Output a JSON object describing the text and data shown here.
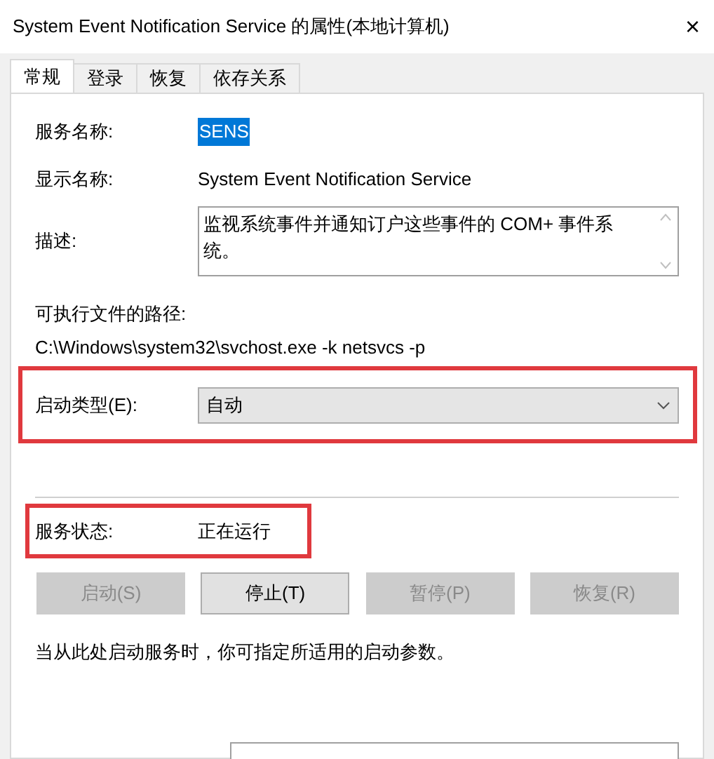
{
  "window": {
    "title": "System Event Notification Service 的属性(本地计算机)",
    "close": "×"
  },
  "tabs": [
    {
      "label": "常规",
      "selected": true
    },
    {
      "label": "登录",
      "selected": false
    },
    {
      "label": "恢复",
      "selected": false
    },
    {
      "label": "依存关系",
      "selected": false
    }
  ],
  "service_name": {
    "label": "服务名称:",
    "value": "SENS"
  },
  "display_name": {
    "label": "显示名称:",
    "value": "System Event Notification Service"
  },
  "description": {
    "label": "描述:",
    "value": "监视系统事件并通知订户这些事件的 COM+ 事件系统。"
  },
  "path": {
    "label": "可执行文件的路径:",
    "value": "C:\\Windows\\system32\\svchost.exe -k netsvcs -p"
  },
  "startup_type": {
    "label": "启动类型(E):",
    "value": "自动"
  },
  "service_status": {
    "label": "服务状态:",
    "value": "正在运行"
  },
  "buttons": [
    {
      "label": "启动(S)",
      "disabled": true
    },
    {
      "label": "停止(T)",
      "disabled": false
    },
    {
      "label": "暂停(P)",
      "disabled": true
    },
    {
      "label": "恢复(R)",
      "disabled": true
    }
  ],
  "hint": "当从此处启动服务时，你可指定所适用的启动参数。"
}
